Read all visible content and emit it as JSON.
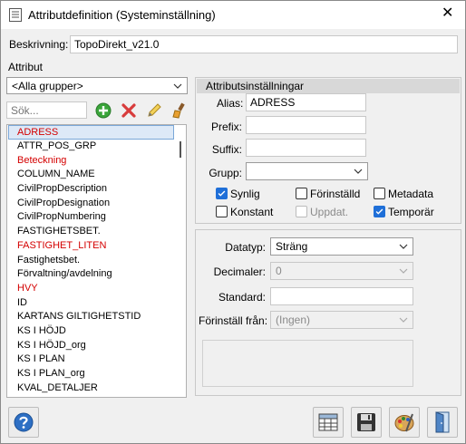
{
  "window": {
    "title": "Attributdefinition (Systeminställning)"
  },
  "description": {
    "label": "Beskrivning:",
    "value": "TopoDirekt_v21.0"
  },
  "attributes": {
    "section_label": "Attribut",
    "group_select": "<Alla grupper>",
    "search_placeholder": "Sök...",
    "items": [
      {
        "text": "ADRESS",
        "red": true
      },
      {
        "text": "ATTR_POS_GRP",
        "red": false
      },
      {
        "text": "Beteckning",
        "red": true
      },
      {
        "text": "COLUMN_NAME",
        "red": false
      },
      {
        "text": "CivilPropDescription",
        "red": false
      },
      {
        "text": "CivilPropDesignation",
        "red": false
      },
      {
        "text": "CivilPropNumbering",
        "red": false
      },
      {
        "text": "FASTIGHETSBET.",
        "red": false
      },
      {
        "text": "FASTIGHET_LITEN",
        "red": true
      },
      {
        "text": "Fastighetsbet.",
        "red": false
      },
      {
        "text": "Förvaltning/avdelning",
        "red": false
      },
      {
        "text": "HVY",
        "red": true
      },
      {
        "text": "ID",
        "red": false
      },
      {
        "text": "KARTANS GILTIGHETSTID",
        "red": false
      },
      {
        "text": "KS I HÖJD",
        "red": false
      },
      {
        "text": "KS I HÖJD_org",
        "red": false
      },
      {
        "text": "KS I PLAN",
        "red": false
      },
      {
        "text": "KS I PLAN_org",
        "red": false
      },
      {
        "text": "KVAL_DETALJER",
        "red": false
      }
    ]
  },
  "settings": {
    "header": "Attributsinställningar",
    "alias_label": "Alias:",
    "alias_value": "ADRESS",
    "prefix_label": "Prefix:",
    "prefix_value": "",
    "suffix_label": "Suffix:",
    "suffix_value": "",
    "group_label": "Grupp:",
    "group_value": "",
    "checks": {
      "synlig": "Synlig",
      "forinstalld": "Förinställd",
      "metadata": "Metadata",
      "konstant": "Konstant",
      "uppdat": "Uppdat.",
      "temporar": "Temporär"
    }
  },
  "datatype": {
    "datatyp_label": "Datatyp:",
    "datatyp_value": "Sträng",
    "decimaler_label": "Decimaler:",
    "decimaler_value": "0",
    "standard_label": "Standard:",
    "standard_value": "",
    "forinstall_label": "Förinställ från:",
    "forinstall_value": "(Ingen)"
  },
  "colors": {
    "accent": "#1f6fd8",
    "red_item": "#d40000",
    "selection": "#dde9f7"
  }
}
